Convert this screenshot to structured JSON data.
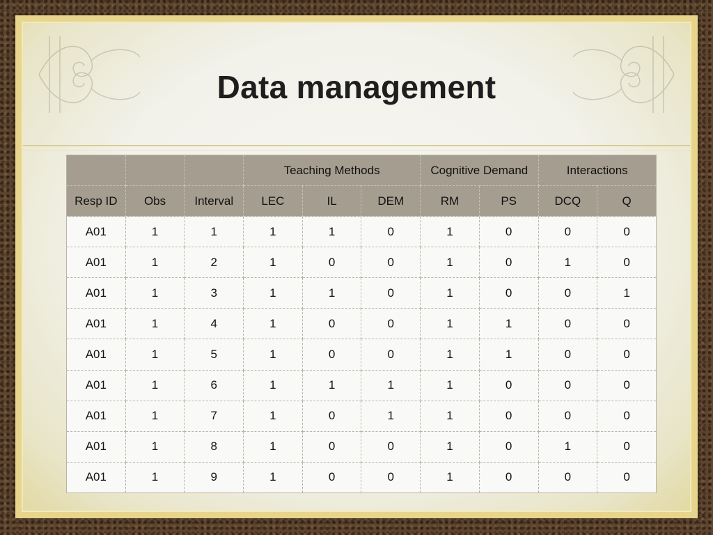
{
  "slide": {
    "title": "Data management"
  },
  "table": {
    "group_headers": [
      "",
      "",
      "",
      "Teaching Methods",
      "Cognitive Demand",
      "Interactions"
    ],
    "columns": [
      "Resp ID",
      "Obs",
      "Interval",
      "LEC",
      "IL",
      "DEM",
      "RM",
      "PS",
      "DCQ",
      "Q"
    ],
    "rows": [
      [
        "A01",
        "1",
        "1",
        "1",
        "1",
        "0",
        "1",
        "0",
        "0",
        "0"
      ],
      [
        "A01",
        "1",
        "2",
        "1",
        "0",
        "0",
        "1",
        "0",
        "1",
        "0"
      ],
      [
        "A01",
        "1",
        "3",
        "1",
        "1",
        "0",
        "1",
        "0",
        "0",
        "1"
      ],
      [
        "A01",
        "1",
        "4",
        "1",
        "0",
        "0",
        "1",
        "1",
        "0",
        "0"
      ],
      [
        "A01",
        "1",
        "5",
        "1",
        "0",
        "0",
        "1",
        "1",
        "0",
        "0"
      ],
      [
        "A01",
        "1",
        "6",
        "1",
        "1",
        "1",
        "1",
        "0",
        "0",
        "0"
      ],
      [
        "A01",
        "1",
        "7",
        "1",
        "0",
        "1",
        "1",
        "0",
        "0",
        "0"
      ],
      [
        "A01",
        "1",
        "8",
        "1",
        "0",
        "0",
        "1",
        "0",
        "1",
        "0"
      ],
      [
        "A01",
        "1",
        "9",
        "1",
        "0",
        "0",
        "1",
        "0",
        "0",
        "0"
      ]
    ]
  },
  "colors": {
    "frame_border": "#5e4530",
    "frame_gold": "#e7d58d",
    "header_fill": "#a59d8f",
    "cell_fill": "#f9f9f7"
  }
}
